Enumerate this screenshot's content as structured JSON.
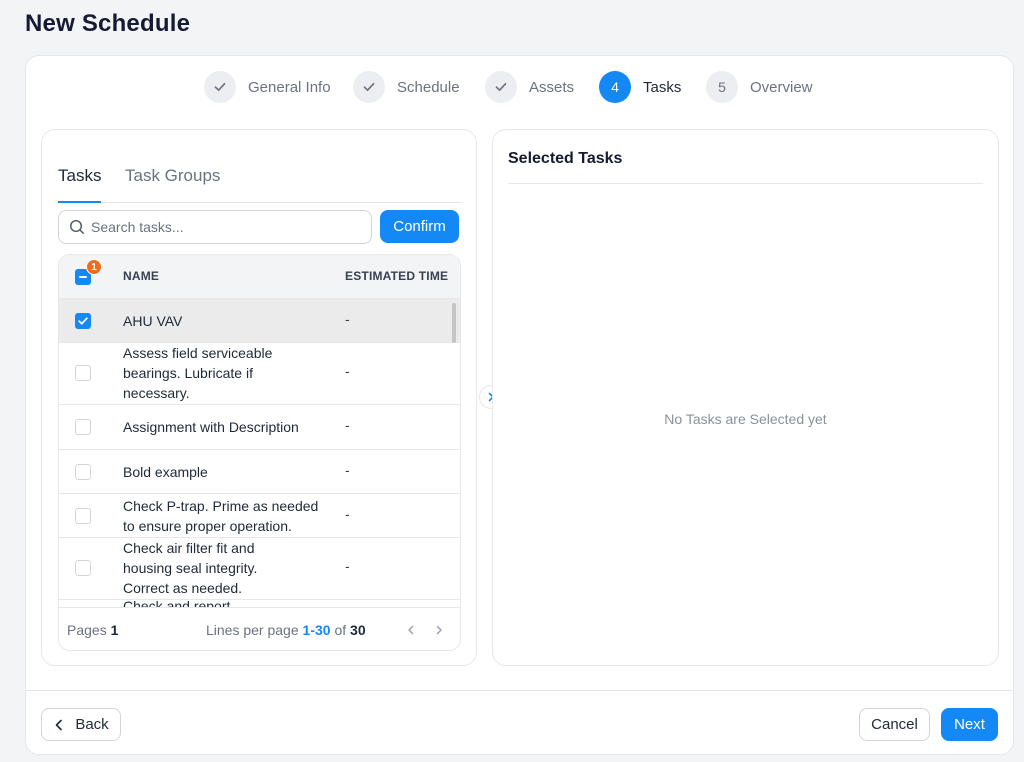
{
  "page": {
    "title": "New Schedule"
  },
  "stepper": {
    "steps": [
      {
        "label": "General Info",
        "marker": "check",
        "status": "completed"
      },
      {
        "label": "Schedule",
        "marker": "check",
        "status": "completed"
      },
      {
        "label": "Assets",
        "marker": "check",
        "status": "completed"
      },
      {
        "label": "Tasks",
        "marker": "4",
        "status": "active"
      },
      {
        "label": "Overview",
        "marker": "5",
        "status": "upcoming"
      }
    ]
  },
  "tasks_panel": {
    "tabs": [
      {
        "label": "Tasks",
        "active": true
      },
      {
        "label": "Task Groups",
        "active": false
      }
    ],
    "search": {
      "placeholder": "Search tasks...",
      "value": ""
    },
    "confirm_label": "Confirm",
    "table": {
      "selected_count": "1",
      "columns": [
        "NAME",
        "ESTIMATED TIME"
      ],
      "rows": [
        {
          "name": "AHU VAV",
          "time": "-",
          "checked": true
        },
        {
          "name": "Assess field serviceable bearings. Lubricate if necessary.",
          "time": "-",
          "checked": false
        },
        {
          "name": "Assignment with Description",
          "time": "-",
          "checked": false
        },
        {
          "name": "Bold example",
          "time": "-",
          "checked": false
        },
        {
          "name": "Check P-trap. Prime as needed to ensure proper operation.",
          "time": "-",
          "checked": false
        },
        {
          "name": "Check air filter fit and housing seal integrity. Correct as needed.",
          "time": "-",
          "checked": false
        },
        {
          "name": "Check and report",
          "time": "-",
          "checked": false
        }
      ],
      "footer": {
        "pages_label": "Pages",
        "pages_value": "1",
        "lines_label": "Lines per page",
        "range": "1-30",
        "of_label": "of",
        "total": "30"
      }
    }
  },
  "selected_panel": {
    "title": "Selected Tasks",
    "empty_text": "No Tasks are Selected yet"
  },
  "footer": {
    "back_label": "Back",
    "cancel_label": "Cancel",
    "next_label": "Next"
  },
  "colors": {
    "accent": "#1488f5",
    "badge": "#f26b1d",
    "title": "#161b33"
  }
}
